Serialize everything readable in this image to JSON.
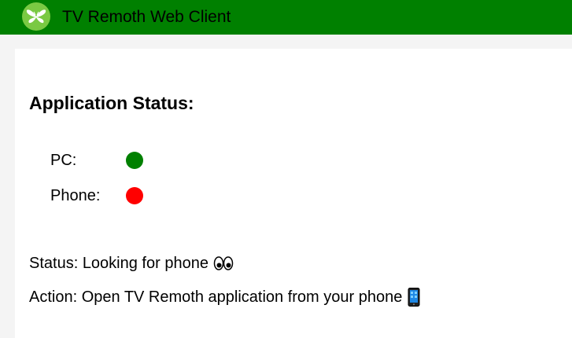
{
  "header": {
    "title": "TV Remoth Web Client",
    "logo_icon": "butterfly-logo-icon",
    "bar_color": "#008000",
    "logo_color": "#7ac943"
  },
  "main": {
    "section_title": "Application Status:",
    "devices": [
      {
        "label": "PC:",
        "state": "connected",
        "color": "#008000"
      },
      {
        "label": "Phone:",
        "state": "disconnected",
        "color": "#ff0000"
      }
    ],
    "status_text": "Status: Looking for phone",
    "status_icon": "eyes-icon",
    "action_text": "Action: Open TV Remoth application from your phone",
    "action_icon": "mobile-phone-icon"
  }
}
